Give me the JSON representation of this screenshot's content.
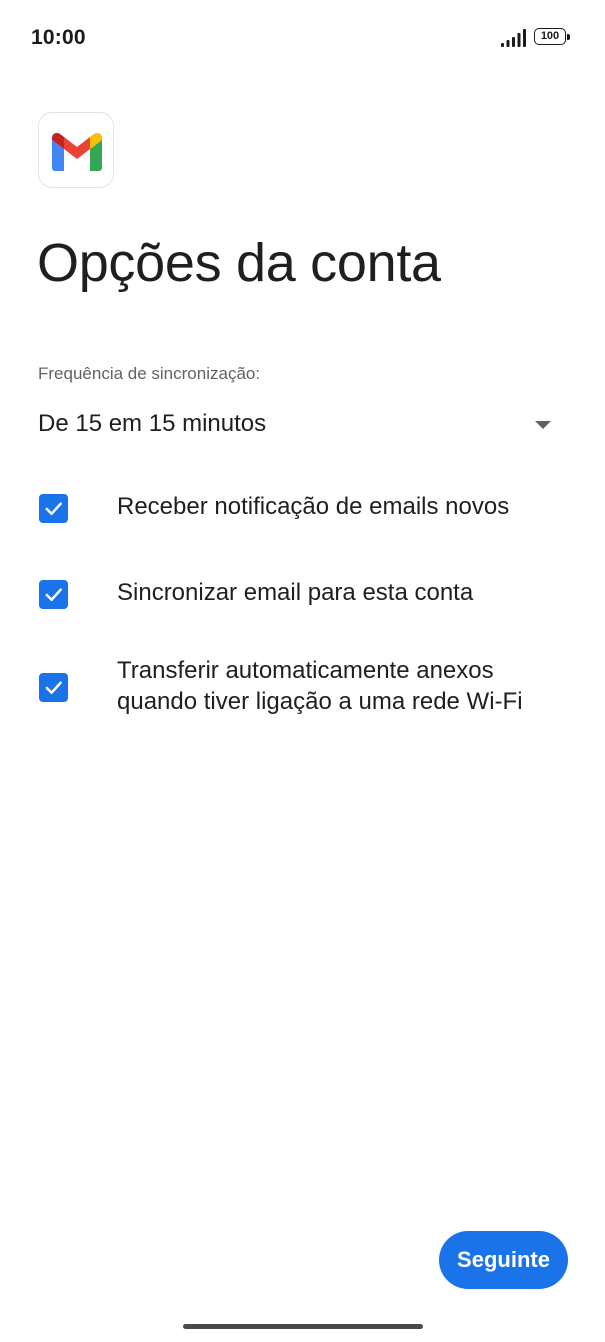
{
  "status_bar": {
    "time": "10:00",
    "battery": "100",
    "signal_icon": "signal-bars-icon",
    "battery_icon": "battery-icon"
  },
  "app": {
    "logo_icon": "gmail-logo-icon"
  },
  "page": {
    "title": "Opções da conta"
  },
  "sync": {
    "label": "Frequência de sincronização:",
    "selected": "De 15 em 15 minutos",
    "dropdown_icon": "dropdown-arrow-icon"
  },
  "options": [
    {
      "label": "Receber notificação de emails novos",
      "checked": true
    },
    {
      "label": "Sincronizar email para esta conta",
      "checked": true
    },
    {
      "label": "Transferir automaticamente anexos quando tiver ligação a uma rede Wi-Fi",
      "checked": true
    }
  ],
  "actions": {
    "next_label": "Seguinte"
  },
  "colors": {
    "accent": "#1a73e8",
    "text_primary": "#1f1f1f",
    "text_secondary": "#5f6368",
    "gmail_red": "#ea4335",
    "gmail_blue": "#4285f4",
    "gmail_green": "#34a853",
    "gmail_yellow": "#fbbc04",
    "gmail_dark_red": "#c5221f"
  }
}
